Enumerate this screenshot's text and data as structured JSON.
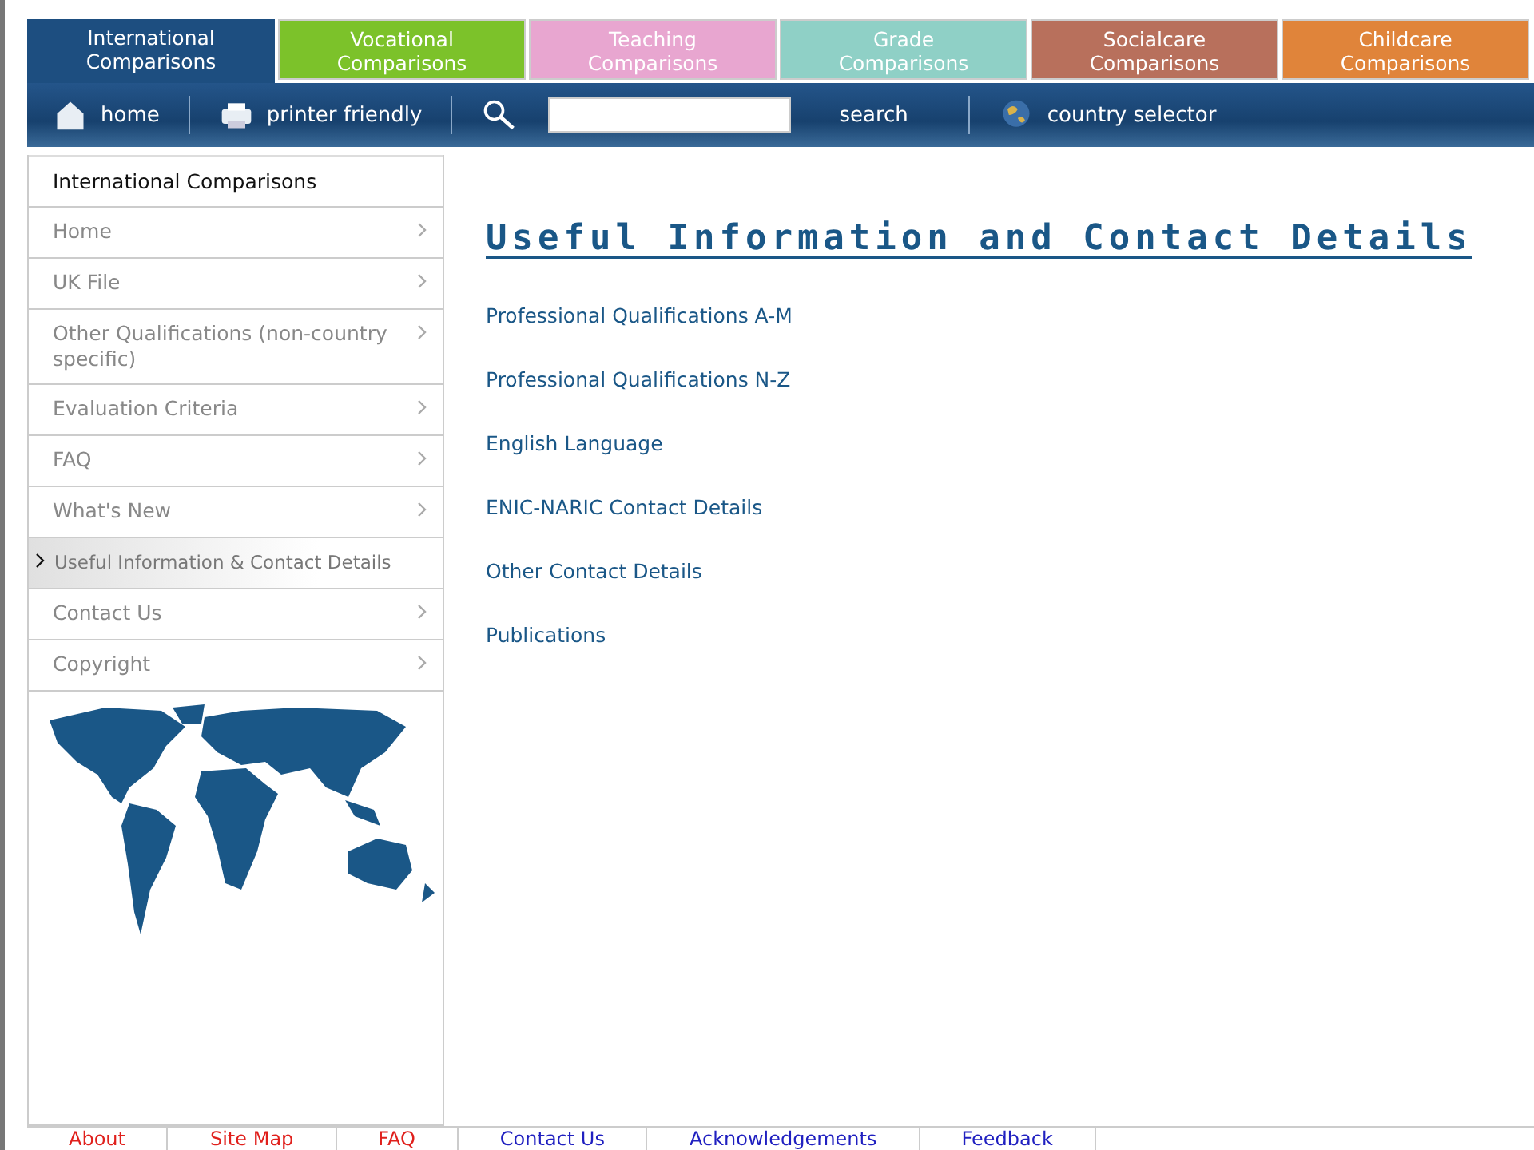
{
  "tabs": [
    {
      "label": "International\nComparisons",
      "selected": true,
      "color": "#1d4e80"
    },
    {
      "label": "Vocational\nComparisons",
      "selected": false,
      "color": "#7cc22a"
    },
    {
      "label": "Teaching\nComparisons",
      "selected": false,
      "color": "#e8a6d0"
    },
    {
      "label": "Grade\nComparisons",
      "selected": false,
      "color": "#8fd0c6"
    },
    {
      "label": "Socialcare\nComparisons",
      "selected": false,
      "color": "#b8705c"
    },
    {
      "label": "Childcare\nComparisons",
      "selected": false,
      "color": "#e0843a"
    }
  ],
  "toolbar": {
    "home": "home",
    "printer": "printer friendly",
    "search_button": "search",
    "country": "country selector"
  },
  "sidebar": {
    "title": "International Comparisons",
    "items": [
      {
        "label": "Home",
        "selected": false
      },
      {
        "label": "UK File",
        "selected": false
      },
      {
        "label": "Other Qualifications (non-country specific)",
        "selected": false
      },
      {
        "label": "Evaluation Criteria",
        "selected": false
      },
      {
        "label": "FAQ",
        "selected": false
      },
      {
        "label": "What's New",
        "selected": false
      },
      {
        "label": "Useful Information & Contact Details",
        "selected": true
      },
      {
        "label": "Contact Us",
        "selected": false
      },
      {
        "label": "Copyright",
        "selected": false
      }
    ]
  },
  "content": {
    "heading": "Useful Information and Contact Details",
    "links": [
      "Professional Qualifications A-M",
      "Professional Qualifications N-Z",
      "English Language",
      "ENIC-NARIC Contact Details",
      "Other Contact Details",
      "Publications"
    ]
  },
  "footer": [
    {
      "label": "About",
      "color": "#e0201c"
    },
    {
      "label": "Site Map",
      "color": "#e0201c"
    },
    {
      "label": "FAQ",
      "color": "#e0201c"
    },
    {
      "label": "Contact Us",
      "color": "#2020c0"
    },
    {
      "label": "Acknowledgements",
      "color": "#2020c0"
    },
    {
      "label": "Feedback",
      "color": "#2020c0"
    }
  ]
}
